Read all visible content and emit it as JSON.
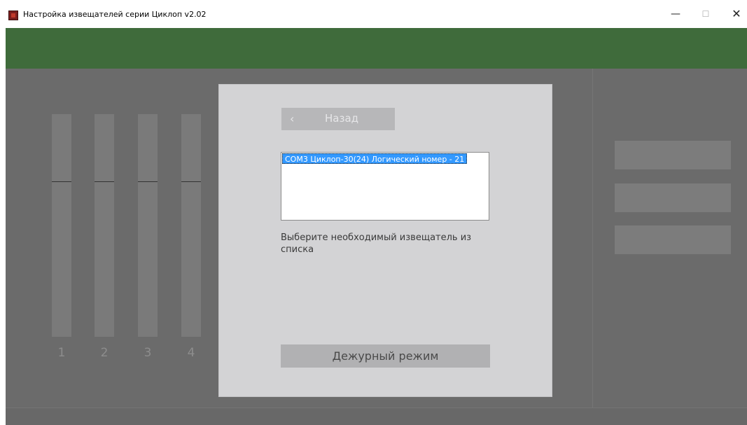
{
  "window": {
    "title": "Настройка извещателей серии Циклоп v2.02",
    "minimize_glyph": "—",
    "maximize_glyph": "☐",
    "close_glyph": "✕",
    "icon": "app-logo-icon"
  },
  "colors": {
    "header_green": "#3f6b3b",
    "background": "#6b6b6b",
    "dialog": "#d3d3d5",
    "selection": "#3399ff"
  },
  "channels": [
    {
      "label": "1"
    },
    {
      "label": "2"
    },
    {
      "label": "3"
    },
    {
      "label": "4"
    }
  ],
  "dialog": {
    "back_icon": "‹",
    "back_label": "Назад",
    "list_items": [
      {
        "text": "COM3 Циклоп-30(24) Логический номер - 21",
        "selected": true
      }
    ],
    "hint": "Выберите необходимый извещатель из списка",
    "duty_button_label": "Дежурный режим"
  }
}
